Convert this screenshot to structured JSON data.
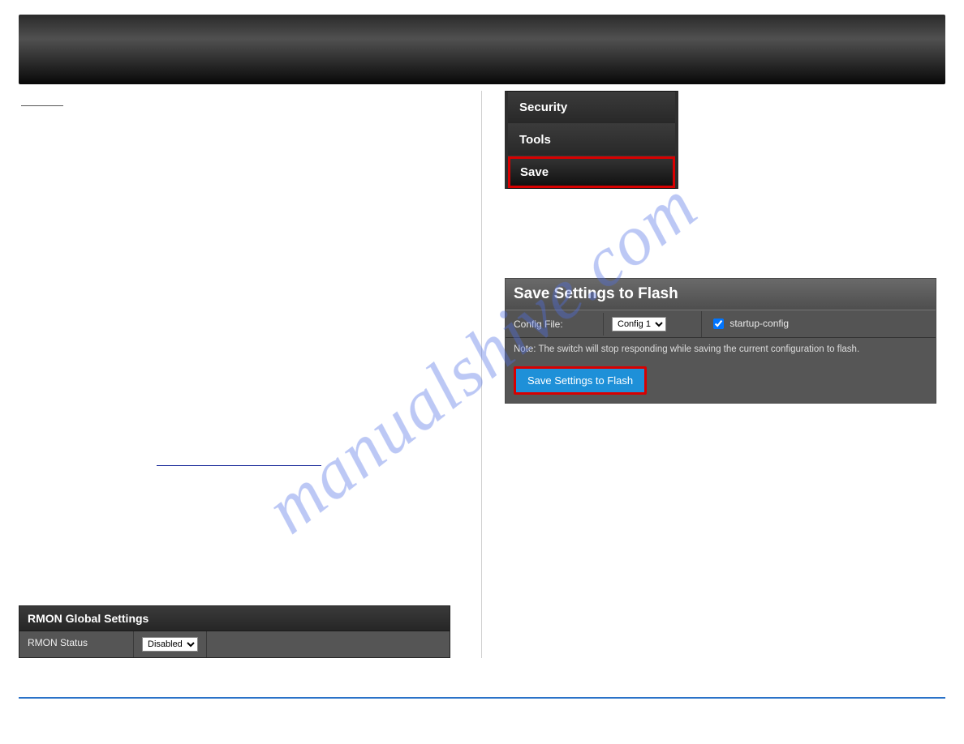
{
  "watermark": "manualshive.com",
  "sidebar": {
    "items": [
      {
        "label": "Security"
      },
      {
        "label": "Tools"
      },
      {
        "label": "Save"
      }
    ]
  },
  "save_panel": {
    "title": "Save Settings to Flash",
    "config_label": "Config File:",
    "config_select": "Config 1",
    "startup_checkbox_label": "startup-config",
    "note": "Note: The switch will stop responding while saving the current configuration to flash.",
    "button": "Save Settings to Flash"
  },
  "rmon_panel": {
    "title": "RMON Global Settings",
    "status_label": "RMON Status",
    "status_value": "Disabled"
  }
}
